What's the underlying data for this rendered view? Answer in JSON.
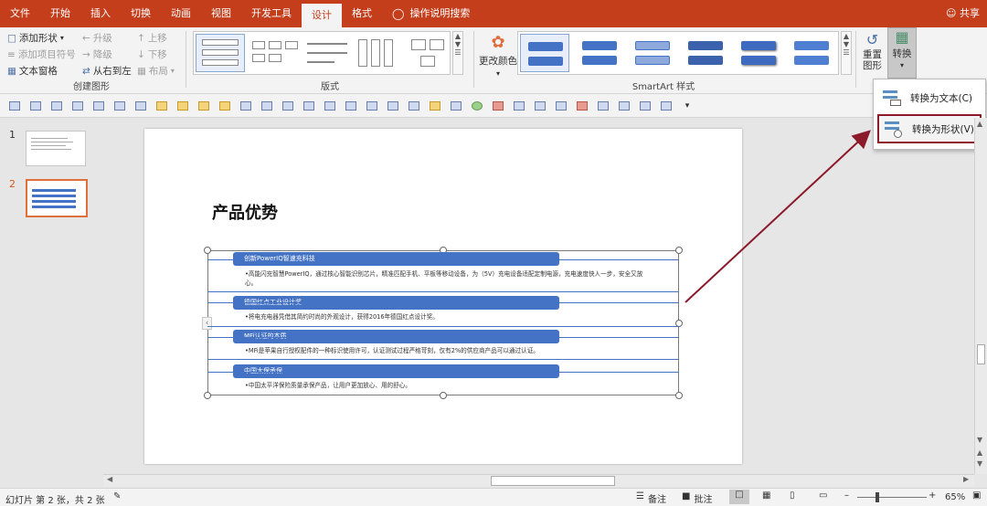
{
  "tabs": [
    "文件",
    "开始",
    "插入",
    "切换",
    "动画",
    "视图",
    "开发工具",
    "设计",
    "格式"
  ],
  "active_tab": "设计",
  "tell_me": "操作说明搜索",
  "share": "共享",
  "ribbon": {
    "create_graphic": {
      "label": "创建图形",
      "add_shape": "添加形状",
      "add_bullet": "添加项目符号",
      "text_pane": "文本窗格",
      "promote": "升级",
      "demote": "降级",
      "right_to_left": "从右到左",
      "move_up": "上移",
      "move_down": "下移",
      "layout": "布局"
    },
    "layouts": {
      "label": "版式"
    },
    "styles": {
      "label": "SmartArt 样式",
      "change_colors": "更改颜色"
    },
    "reset": {
      "reset_graphic": "重置\n图形",
      "convert": "转换"
    }
  },
  "convert_menu": {
    "to_text": "转换为文本(C)",
    "to_shapes": "转换为形状(V)"
  },
  "slides": [
    {
      "num": "1"
    },
    {
      "num": "2"
    }
  ],
  "slide": {
    "title": "产品优势",
    "items": [
      {
        "head": "创新PowerIQ智速充科技",
        "body": "•高能闪充智慧PowerIQ，通过核心智能识别芯片，精准匹配手机、平板等移动设备，为（5V）充电设备适配定制电源，充电速度快人一步，安全又放心。"
      },
      {
        "head": "德国红点工业设计奖",
        "body": "•将电充电器凭借其简约时尚的外观设计，获得2016年德国红点设计奖。"
      },
      {
        "head": "MFi认证的本质",
        "body": "•MFi是苹果自行授权配件的一种标识使用许可，认证测试过程严格苛刻，仅有2%的供应商产品可以通过认证。"
      },
      {
        "head": "中国太保承保",
        "body": "•中国太平洋保险质量承保产品，让用户更加放心、用的舒心。"
      }
    ]
  },
  "status": {
    "slide_info": "幻灯片 第 2 张，共 2 张",
    "notes": "备注",
    "comments": "批注",
    "zoom": "65%"
  },
  "colors": {
    "accent": "#c43e1c",
    "smartart_blue": "#4472c4",
    "highlight": "#8b1a2b"
  }
}
